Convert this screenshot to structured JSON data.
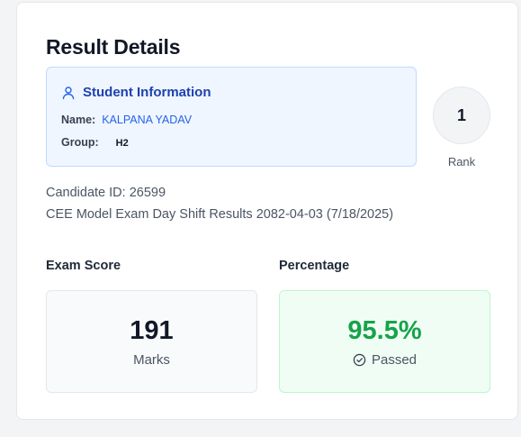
{
  "card": {
    "title": "Result Details"
  },
  "student": {
    "header": "Student Information",
    "icon": "user-icon",
    "name_label": "Name:",
    "name": "KALPANA YADAV",
    "group_label": "Group:",
    "group": "H2"
  },
  "rank": {
    "value": "1",
    "label": "Rank"
  },
  "meta": {
    "candidate": "Candidate ID: 26599",
    "exam": "CEE Model Exam Day Shift Results 2082-04-03 (7/18/2025)"
  },
  "score": {
    "label": "Exam Score",
    "value": "191",
    "unit": "Marks"
  },
  "percentage": {
    "label": "Percentage",
    "value": "95.5%",
    "status": "Passed",
    "status_icon": "check-circle-icon"
  },
  "colors": {
    "accent_blue": "#1e40af",
    "name_blue": "#2563eb",
    "success_green": "#16a34a"
  }
}
